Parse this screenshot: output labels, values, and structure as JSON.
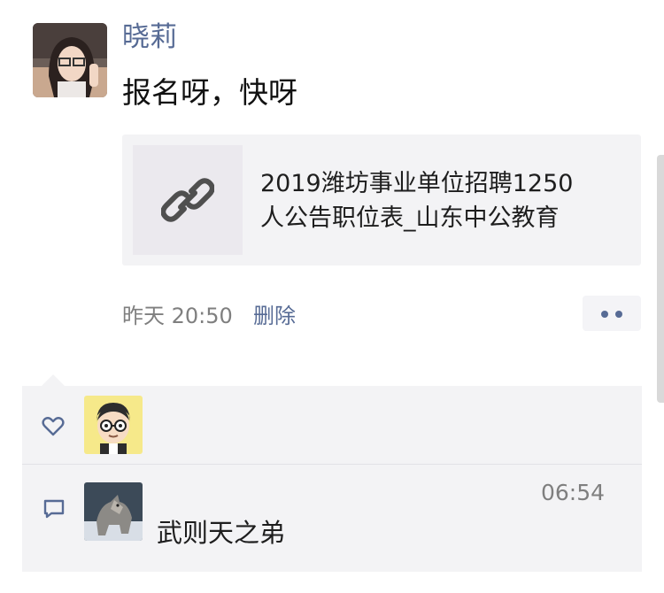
{
  "post": {
    "author": "晓莉",
    "text": "报名呀，快呀",
    "link": {
      "title_line1": "2019潍坊事业单位招聘1250",
      "title_line2": "人公告职位表_山东中公教育",
      "icon": "link-icon"
    },
    "time": "昨天 20:50",
    "delete_label": "删除",
    "more_icon": "more-dots-icon"
  },
  "interactions": {
    "like_icon": "heart-outline-icon",
    "comment_icon": "comment-bubble-icon",
    "comment": {
      "name": "",
      "time": "06:54",
      "text": "武则天之弟"
    }
  },
  "colors": {
    "link_blue": "#576b95",
    "panel_bg": "#f3f3f5",
    "meta_gray": "#7f7f7f"
  }
}
